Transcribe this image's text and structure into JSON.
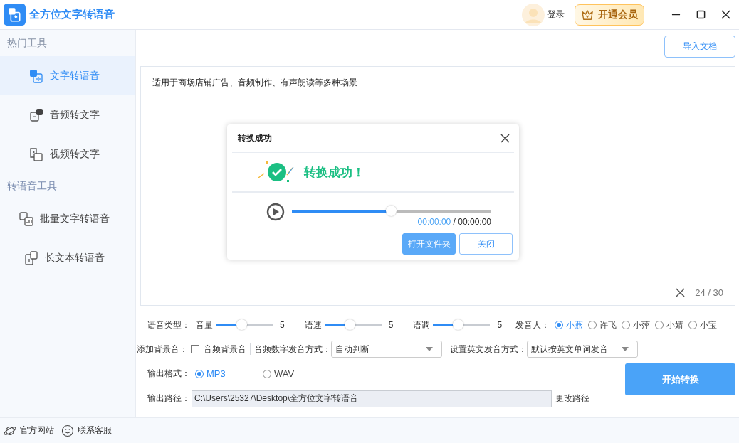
{
  "app": {
    "title": "全方位文字转语音"
  },
  "header": {
    "login": "登录",
    "vip": "开通会员"
  },
  "sidebar": {
    "groups": [
      {
        "title": "热门工具",
        "items": [
          {
            "label": "文字转语音",
            "selected": true
          },
          {
            "label": "音频转文字",
            "selected": false
          },
          {
            "label": "视频转文字",
            "selected": false
          }
        ]
      },
      {
        "title": "转语音工具",
        "items": [
          {
            "label": "批量文字转语音",
            "selected": false
          },
          {
            "label": "长文本转语音",
            "selected": false
          }
        ]
      }
    ]
  },
  "footer": {
    "links": [
      {
        "label": "官方网站"
      },
      {
        "label": "联系客服"
      }
    ]
  },
  "import_button": "导入文档",
  "editor": {
    "text": "适用于商场店铺广告、音频制作、有声朗读等多种场景",
    "counter": "24 / 30"
  },
  "dialog": {
    "title": "转换成功",
    "message": "转换成功！",
    "player": {
      "level": 0.5,
      "current": "00:00:00",
      "separator": "/",
      "total": "00:00:00"
    },
    "buttons": [
      {
        "label": "打开文件夹"
      },
      {
        "label": "关闭"
      }
    ]
  },
  "settings": {
    "voice_label": "语音类型：",
    "sliders": [
      {
        "label": "音量",
        "level": 0.46,
        "value": "5"
      },
      {
        "label": "语速",
        "level": 0.45,
        "value": "5"
      },
      {
        "label": "语调",
        "level": 0.45,
        "value": "5"
      }
    ],
    "speaker_label": "发音人：",
    "speakers": [
      {
        "label": "小燕",
        "selected": true
      },
      {
        "label": "许飞",
        "selected": false
      },
      {
        "label": "小萍",
        "selected": false
      },
      {
        "label": "小婧",
        "selected": false
      },
      {
        "label": "小宝",
        "selected": false
      }
    ],
    "bg_label": "添加背景音：",
    "bg_checkbox": {
      "label": "音频背景音",
      "checked": false
    },
    "number_mode": {
      "label": "音频数字发音方式：",
      "value": "自动判断"
    },
    "english_mode": {
      "label": "设置英文发音方式：",
      "value": "默认按英文单词发音"
    },
    "format_label": "输出格式：",
    "formats": [
      {
        "label": "MP3",
        "selected": true
      },
      {
        "label": "WAV",
        "selected": false
      }
    ],
    "path_label": "输出路径：",
    "path_value": "C:\\Users\\25327\\Desktop\\全方位文字转语音",
    "change_path": "更改路径",
    "start_button": "开始转换"
  }
}
